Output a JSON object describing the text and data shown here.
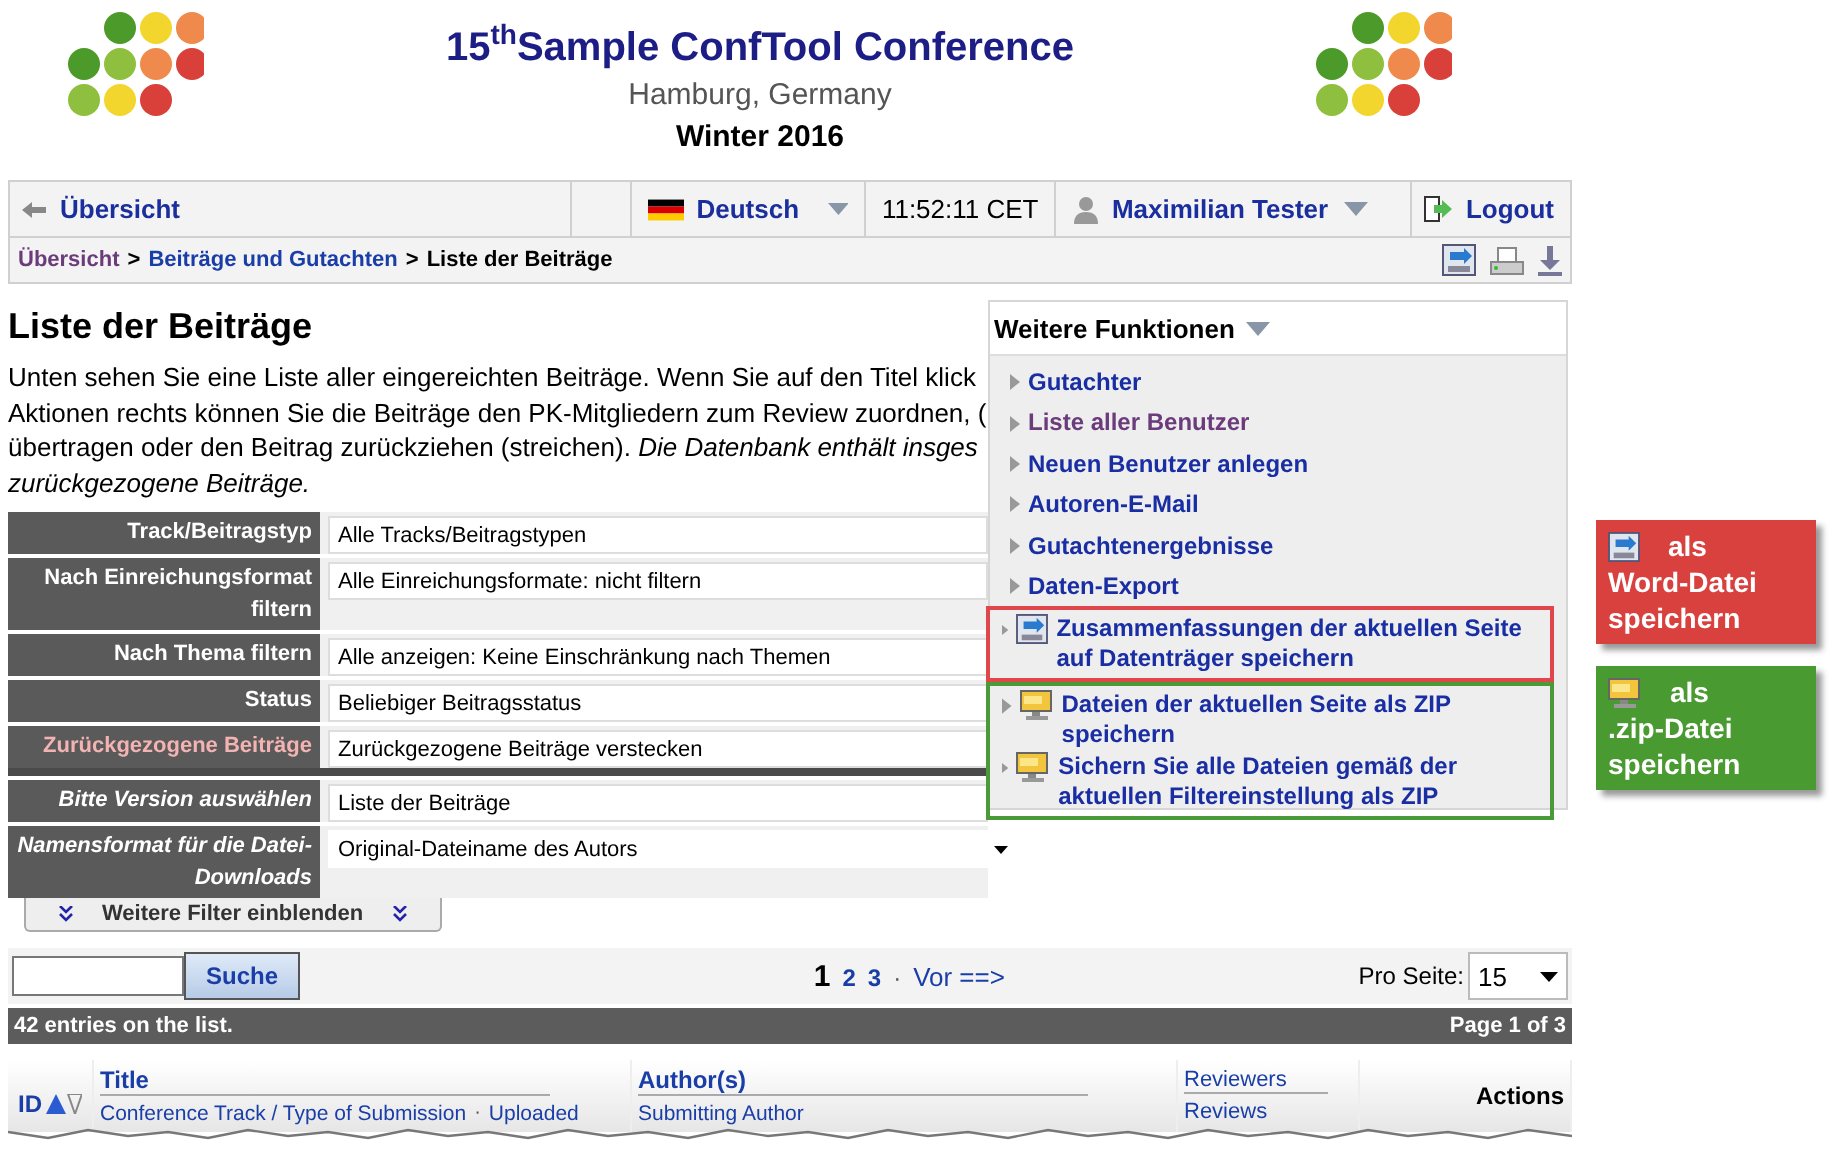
{
  "header": {
    "title": "15$^{th}$Sample ConfTool Conference",
    "location": "Hamburg, Germany",
    "season": "Winter 2016"
  },
  "navbar": {
    "home": "Übersicht",
    "language": "Deutsch",
    "time": "11:52:11 CET",
    "user": "Maximilian Tester",
    "logout": "Logout"
  },
  "breadcrumb": [
    {
      "label": "Übersicht",
      "kind": "visited"
    },
    {
      "label": "Beiträge und Gutachten",
      "kind": "link"
    },
    {
      "label": "Liste der Beiträge",
      "kind": "current"
    }
  ],
  "breadcrumb_separator": ">",
  "heading": "Liste der Beiträge",
  "description": [
    "Unten sehen Sie eine Liste aller eingereichten Beiträge. Wenn Sie auf den Titel klick",
    "Aktionen rechts können Sie die Beiträge den PK-Mitgliedern zum Review zuordnen, (",
    "übertragen oder den Beitrag zurückziehen (streichen). *Die Datenbank enthält insges*",
    "*zurückgezogene Beiträge.*"
  ],
  "filter_groups": [
    [
      {
        "label": "Track/Beitragstyp",
        "value": "Alle Tracks/Beitragstypen",
        "kind": "filter"
      },
      {
        "label": "Nach Einreichungsformat filtern",
        "value": "Alle Einreichungsformate: nicht filtern",
        "kind": "filter"
      },
      {
        "label": "Nach Thema filtern",
        "value": "Alle anzeigen: Keine Einschränkung nach Themen",
        "kind": "filter"
      },
      {
        "label": "Status",
        "value": "Beliebiger Beitragsstatus",
        "kind": "filter"
      },
      {
        "label": "Zurückgezogene Beiträge",
        "value": "Zurückgezogene Beiträge verstecken",
        "kind": "withdrawn"
      }
    ],
    [
      {
        "label": "Bitte Version auswählen",
        "value": "Liste der Beiträge",
        "kind": "option"
      },
      {
        "label": "Namensformat für die Datei-Downloads",
        "value": "Original-Dateiname des Autors",
        "kind": "dropdown"
      }
    ]
  ],
  "more_filters": "Weitere Filter einblenden",
  "functions": {
    "title": "Weitere Funktionen",
    "items": [
      {
        "label": "Gutachter",
        "visited": false
      },
      {
        "label": "Liste aller Benutzer",
        "visited": true
      },
      {
        "label": "Neuen Benutzer anlegen",
        "visited": false
      },
      {
        "label": "Autoren-E-Mail",
        "visited": false
      },
      {
        "label": "Gutachtenergebnisse",
        "visited": false
      },
      {
        "label": "Daten-Export",
        "visited": false
      }
    ],
    "framed_groups": [
      {
        "color": "#e0474c",
        "items": [
          {
            "label": "Zusammenfassungen der aktuellen Seite auf Datenträger speichern",
            "kind": "document"
          }
        ]
      },
      {
        "color": "#4b9a38",
        "items": [
          {
            "label": "Dateien der aktuellen Seite als ZIP speichern",
            "kind": "archive"
          },
          {
            "label": "Sichern Sie **alle** Dateien gemäß der aktuellen Filtereinstellung als ZIP",
            "kind": "archive"
          }
        ]
      }
    ]
  },
  "callouts": [
    {
      "color": "#d9413f",
      "kind": "document",
      "lead": "als",
      "text": "Word-Datei speichern"
    },
    {
      "color": "#4a9a32",
      "kind": "archive",
      "lead": "als",
      "text": ".zip-Datei speichern"
    }
  ],
  "search": {
    "button": "Suche"
  },
  "pagination": {
    "pages": [
      {
        "label": "1",
        "selected": true
      },
      {
        "label": "2",
        "selected": false
      },
      {
        "label": "3",
        "selected": false
      }
    ],
    "separator": "·",
    "next": "Vor ==>"
  },
  "per_page": {
    "label": "Pro Seite:",
    "value": "15"
  },
  "status_bar": {
    "count": "42 entries on the list.",
    "page": "Page 1 of 3"
  },
  "table": {
    "columns": [
      {
        "kind": "id",
        "top": "ID"
      },
      {
        "kind": "double",
        "top": "Title",
        "bottom": "Conference Track / Type of Submission",
        "separator": "·",
        "extra": "Uploaded"
      },
      {
        "kind": "double",
        "top": "Author(s)",
        "bottom": "Submitting Author"
      },
      {
        "kind": "double",
        "top": "Reviewers",
        "bottom": "Reviews"
      },
      {
        "kind": "plain",
        "top": "Actions"
      }
    ]
  }
}
